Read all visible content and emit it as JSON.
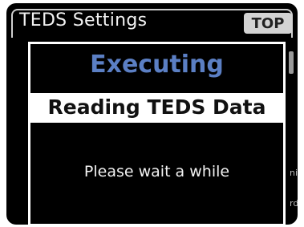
{
  "title_bar": {
    "title": "TEDS Settings",
    "top_button_label": "TOP"
  },
  "background_fragments": {
    "right_1": "nit",
    "right_2": "rd"
  },
  "dialog": {
    "status": "Executing",
    "header": "Reading TEDS Data",
    "message": "Please wait a while"
  },
  "colors": {
    "screen_bg": "#000000",
    "status_blue": "#5b7fc4",
    "top_button_bg": "#d3d3d3"
  }
}
